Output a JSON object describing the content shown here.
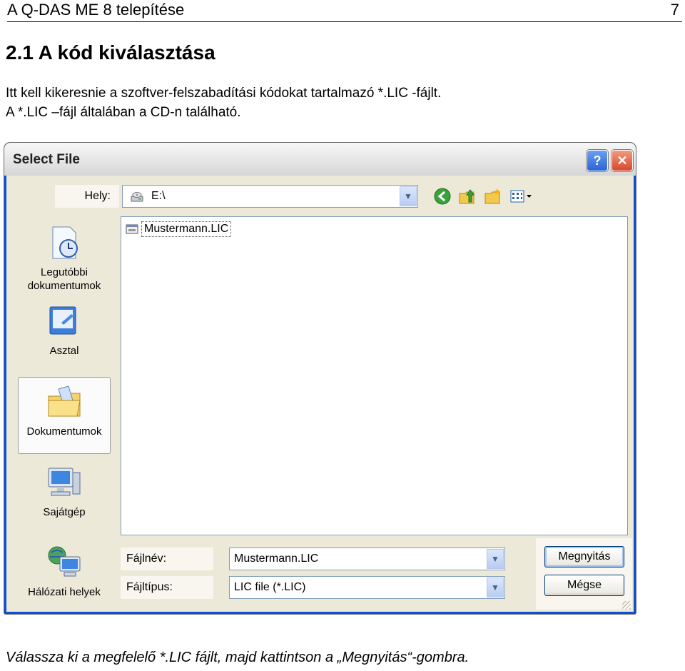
{
  "doc": {
    "header_title": "A Q-DAS ME 8 telepítése",
    "page_number": "7",
    "section_title": "2.1  A kód kiválasztása",
    "body_line1": "Itt kell kikeresnie a szoftver-felszabadítási kódokat tartalmazó *.LIC -fájlt.",
    "body_line2": "A *.LIC –fájl általában a CD-n található.",
    "caption": "Válassza ki a megfelelő  *.LIC fájlt, majd kattintson a „Megnyitás“-gombra."
  },
  "dialog": {
    "title": "Select File",
    "help_button": "?",
    "close_button": "✕",
    "look_in_label": "Hely:",
    "look_in_value": "E:\\",
    "places": [
      {
        "label": "Legutóbbi dokumentumok",
        "icon": "recent-documents-icon"
      },
      {
        "label": "Asztal",
        "icon": "desktop-icon"
      },
      {
        "label": "Dokumentumok",
        "icon": "my-documents-icon"
      },
      {
        "label": "Sajátgép",
        "icon": "my-computer-icon"
      },
      {
        "label": "Hálózati helyek",
        "icon": "network-places-icon"
      }
    ],
    "files": [
      {
        "name": "Mustermann.LIC",
        "icon": "license-file-icon"
      }
    ],
    "filename_label": "Fájlnév:",
    "filename_value": "Mustermann.LIC",
    "filetype_label": "Fájltípus:",
    "filetype_value": "LIC file (*.LIC)",
    "open_button": "Megnyitás",
    "cancel_button": "Mégse"
  }
}
